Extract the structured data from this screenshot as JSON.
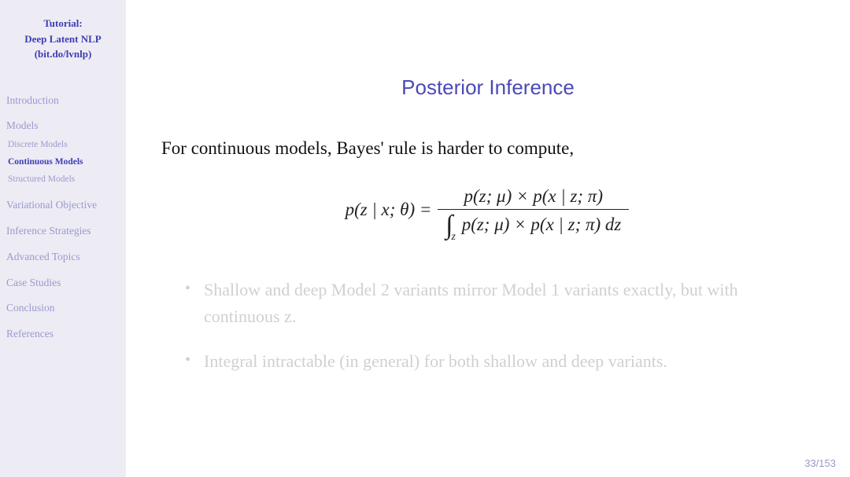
{
  "sidebar": {
    "title_line1": "Tutorial:",
    "title_line2": "Deep Latent NLP",
    "title_line3": "(bit.do/lvnlp)",
    "items": [
      {
        "label": "Introduction",
        "subs": []
      },
      {
        "label": "Models",
        "subs": [
          {
            "label": "Discrete Models",
            "active": false
          },
          {
            "label": "Continuous Models",
            "active": true
          },
          {
            "label": "Structured Models",
            "active": false
          }
        ]
      },
      {
        "label": "Variational Objective",
        "subs": []
      },
      {
        "label": "Inference Strategies",
        "subs": []
      },
      {
        "label": "Advanced Topics",
        "subs": []
      },
      {
        "label": "Case Studies",
        "subs": []
      },
      {
        "label": "Conclusion",
        "subs": []
      },
      {
        "label": "References",
        "subs": []
      }
    ]
  },
  "slide": {
    "title": "Posterior Inference",
    "lead": "For continuous models, Bayes' rule is harder to compute,",
    "eq_lhs": "p(z | x; θ) =",
    "eq_num": "p(z; μ) × p(x | z; π)",
    "eq_den_expr": "p(z; μ) × p(x | z; π) dz",
    "bullets": [
      "Shallow and deep Model 2 variants mirror Model 1 variants exactly, but with continuous z.",
      "Integral intractable (in general) for both shallow and deep variants."
    ],
    "page": "33/153"
  }
}
